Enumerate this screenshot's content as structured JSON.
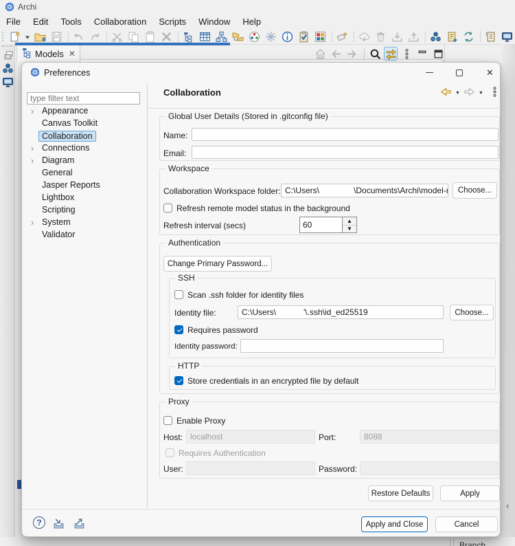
{
  "window": {
    "title": "Archi",
    "menus": [
      "File",
      "Edit",
      "Tools",
      "Collaboration",
      "Scripts",
      "Window",
      "Help"
    ]
  },
  "toolbar_icons": [
    {
      "name": "new-model-icon",
      "kind": "docstar"
    },
    {
      "name": "new-dropdown-caret",
      "kind": "caretd"
    },
    {
      "name": "open-model-icon",
      "kind": "folder"
    },
    {
      "name": "save-icon",
      "kind": "floppy",
      "disabled": true
    },
    {
      "kind": "sep"
    },
    {
      "name": "undo-icon",
      "kind": "undo",
      "disabled": true
    },
    {
      "name": "redo-icon",
      "kind": "redo",
      "disabled": true
    },
    {
      "kind": "sep"
    },
    {
      "name": "cut-icon",
      "kind": "scissors",
      "disabled": true
    },
    {
      "name": "copy-icon",
      "kind": "copy",
      "disabled": true
    },
    {
      "name": "paste-icon",
      "kind": "paste",
      "disabled": true
    },
    {
      "name": "delete-icon",
      "kind": "delx",
      "disabled": true
    },
    {
      "kind": "sep"
    },
    {
      "name": "model-tree-icon",
      "kind": "tree"
    },
    {
      "name": "table-view-icon",
      "kind": "table"
    },
    {
      "name": "diagram-icon",
      "kind": "layout"
    },
    {
      "name": "folder-tree-icon",
      "kind": "foldertree"
    },
    {
      "name": "color-wheel-icon",
      "kind": "colorwheel"
    },
    {
      "name": "snowflake-icon",
      "kind": "snow"
    },
    {
      "name": "info-icon",
      "kind": "info"
    },
    {
      "name": "validate-icon",
      "kind": "clipcheck"
    },
    {
      "name": "color-grid-icon",
      "kind": "grid4"
    },
    {
      "kind": "sep"
    },
    {
      "name": "sketch-icon",
      "kind": "eraser"
    },
    {
      "kind": "sep"
    },
    {
      "name": "cloud-sync-icon",
      "kind": "cloud",
      "disabled": true
    },
    {
      "name": "trash-icon",
      "kind": "trash",
      "disabled": true
    },
    {
      "name": "import-icon",
      "kind": "traydown",
      "disabled": true
    },
    {
      "name": "export-icon",
      "kind": "trayup",
      "disabled": true
    },
    {
      "kind": "sep"
    },
    {
      "name": "collaboration-icon",
      "kind": "dots3"
    },
    {
      "name": "new-doc-icon",
      "kind": "docplus"
    },
    {
      "name": "refresh-icon",
      "kind": "sync"
    },
    {
      "kind": "sep"
    },
    {
      "name": "script-icon",
      "kind": "scroll"
    },
    {
      "name": "console-icon",
      "kind": "monitor"
    },
    {
      "kind": "sep"
    },
    {
      "name": "restore-windows-icon",
      "kind": "winrestore",
      "disabled": true
    },
    {
      "name": "folder-hierarchy-icon",
      "kind": "foldertree"
    }
  ],
  "viewbar_icons": [
    {
      "name": "home-icon",
      "kind": "home",
      "disabled": true
    },
    {
      "name": "back-icon",
      "kind": "arrowl",
      "disabled": true
    },
    {
      "name": "forward-icon",
      "kind": "arrowr",
      "disabled": true
    },
    {
      "kind": "vsep"
    },
    {
      "name": "search-icon",
      "kind": "search"
    },
    {
      "name": "link-editor-icon",
      "kind": "link",
      "highlight": true
    },
    {
      "name": "view-menu-icon",
      "kind": "kebab"
    },
    {
      "name": "minimize-view-icon",
      "kind": "minbar"
    },
    {
      "name": "maximize-view-icon",
      "kind": "maxbox"
    }
  ],
  "models_view": {
    "tab_label": "Models"
  },
  "background": {
    "branch_label": "Branch"
  },
  "dialog": {
    "title": "Preferences",
    "filter_placeholder": "type filter text",
    "tree": [
      {
        "label": "Appearance",
        "expandable": true
      },
      {
        "label": "Canvas Toolkit"
      },
      {
        "label": "Collaboration",
        "selected": true
      },
      {
        "label": "Connections",
        "expandable": true
      },
      {
        "label": "Diagram",
        "expandable": true
      },
      {
        "label": "General"
      },
      {
        "label": "Jasper Reports"
      },
      {
        "label": "Lightbox"
      },
      {
        "label": "Scripting"
      },
      {
        "label": "System",
        "expandable": true
      },
      {
        "label": "Validator"
      }
    ],
    "header": "Collaboration",
    "global": {
      "legend": "Global User Details (Stored in .gitconfig file)",
      "name_label": "Name:",
      "name_value": "",
      "email_label": "Email:",
      "email_value": ""
    },
    "workspace": {
      "legend": "Workspace",
      "folder_label": "Collaboration Workspace folder:",
      "folder_value": "C:\\Users\\               \\Documents\\Archi\\model-re",
      "choose_label": "Choose...",
      "refresh_label": "Refresh remote model status in the background",
      "refresh_checked": false,
      "interval_label": "Refresh interval (secs)",
      "interval_value": "60"
    },
    "auth": {
      "legend": "Authentication",
      "change_password_label": "Change Primary Password...",
      "ssh": {
        "legend": "SSH",
        "scan_label": "Scan .ssh folder for identity files",
        "scan_checked": false,
        "identity_label": "Identity file:",
        "identity_value": "C:\\Users\\            '\\.ssh\\id_ed25519",
        "choose_label": "Choose...",
        "requires_label": "Requires password",
        "requires_checked": true,
        "password_label": "Identity password:",
        "password_value": ""
      },
      "http": {
        "legend": "HTTP",
        "store_label": "Store credentials in an encrypted file by default",
        "store_checked": true
      }
    },
    "proxy": {
      "legend": "Proxy",
      "enable_label": "Enable Proxy",
      "enable_checked": false,
      "host_label": "Host:",
      "host_value": "localhost",
      "port_label": "Port:",
      "port_value": "8088",
      "requires_label": "Requires Authentication",
      "requires_checked": false,
      "user_label": "User:",
      "user_value": "",
      "password_label": "Password:",
      "password_value": ""
    },
    "buttons": {
      "restore_defaults": "Restore Defaults",
      "apply": "Apply",
      "apply_and_close": "Apply and Close",
      "cancel": "Cancel"
    }
  }
}
